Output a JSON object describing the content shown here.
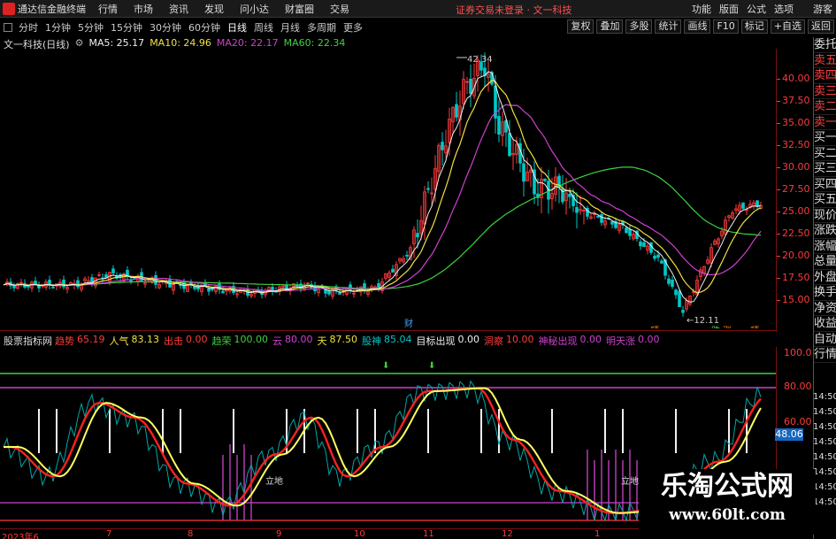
{
  "app": {
    "title": "通达信金融终端"
  },
  "menus": [
    "行情",
    "市场",
    "资讯",
    "发现",
    "问小达",
    "财富圈",
    "交易"
  ],
  "login_warning": "证券交易未登录 · 文一科技",
  "right_menus": [
    "功能",
    "版面",
    "公式",
    "选项"
  ],
  "guest": "游客",
  "toolbar": {
    "tabs": [
      "分时",
      "1分钟",
      "5分钟",
      "15分钟",
      "30分钟",
      "60分钟",
      "日线",
      "周线",
      "月线",
      "多周期",
      "更多"
    ],
    "active_tab": "日线",
    "buttons": [
      "复权",
      "叠加",
      "多股",
      "统计",
      "画线",
      "F10",
      "标记",
      "+自选",
      "返回"
    ]
  },
  "stock": {
    "name": "文一科技(日线)",
    "ma5": "MA5: 25.17",
    "ma10": "MA10: 24.96",
    "ma20": "MA20: 22.17",
    "ma60": "MA60: 22.34"
  },
  "colors": {
    "up": "#ff3b3b",
    "down": "#00c8c8",
    "ma5": "#f0f0f0",
    "ma10": "#f0e040",
    "ma20": "#d040d0",
    "ma60": "#40d040",
    "axis": "#ff3b3b"
  },
  "price_axis": {
    "labels": [
      "40.00",
      "37.50",
      "35.00",
      "32.50",
      "30.00",
      "27.50",
      "25.00",
      "22.50",
      "20.00",
      "17.50",
      "15.00"
    ]
  },
  "annotations": {
    "high": "42.34",
    "low": "←12.11",
    "markers": [
      {
        "text": "财",
        "color": "#40a0ff"
      },
      {
        "text": "预",
        "color": "#ff8000"
      },
      {
        "text": "跌",
        "color": "#40d040"
      },
      {
        "text": "涨",
        "color": "#ff8000"
      },
      {
        "text": "预",
        "color": "#ff8000"
      }
    ]
  },
  "indicator": {
    "name": "股票指标网",
    "items": [
      {
        "label": "趋势",
        "value": "65.19",
        "color": "#ff3b3b"
      },
      {
        "label": "人气",
        "value": "83.13",
        "color": "#f0e040"
      },
      {
        "label": "出击",
        "value": "0.00",
        "color": "#ff3b3b"
      },
      {
        "label": "趋荣",
        "value": "100.00",
        "color": "#40d040"
      },
      {
        "label": "云",
        "value": "80.00",
        "color": "#d040d0"
      },
      {
        "label": "天",
        "value": "87.50",
        "color": "#f0e040"
      },
      {
        "label": "股神",
        "value": "85.04",
        "color": "#00c8c8"
      },
      {
        "label": "目标出现",
        "value": "0.00",
        "color": "#f0f0f0"
      },
      {
        "label": "洞察",
        "value": "10.00",
        "color": "#ff3b3b"
      },
      {
        "label": "神秘出现",
        "value": "0.00",
        "color": "#d040d0"
      },
      {
        "label": "明天涨",
        "value": "0.00",
        "color": "#d040d0"
      }
    ],
    "axis_labels": [
      "100.0",
      "80.00",
      "60.00"
    ],
    "current_value": "48.06",
    "marks": [
      "立地",
      "立地"
    ]
  },
  "side_panel": {
    "items": [
      "委托",
      "卖五",
      "卖四",
      "卖三",
      "卖二",
      "卖一",
      "买一",
      "买二",
      "买三",
      "买四",
      "买五",
      "现价",
      "涨跌",
      "涨幅",
      "总量",
      "外盘",
      "换手",
      "净资",
      "收益",
      "自动",
      "行情"
    ],
    "times": [
      "14:50",
      "14:50",
      "14:50",
      "14:50",
      "14:50",
      "14:50",
      "14:50",
      "14:50"
    ]
  },
  "date_axis": {
    "labels": [
      "2023年6",
      "7",
      "8",
      "9",
      "10",
      "11",
      "12",
      "1"
    ]
  },
  "watermark": {
    "title": "乐淘公式网",
    "url": "www.60lt.com"
  }
}
